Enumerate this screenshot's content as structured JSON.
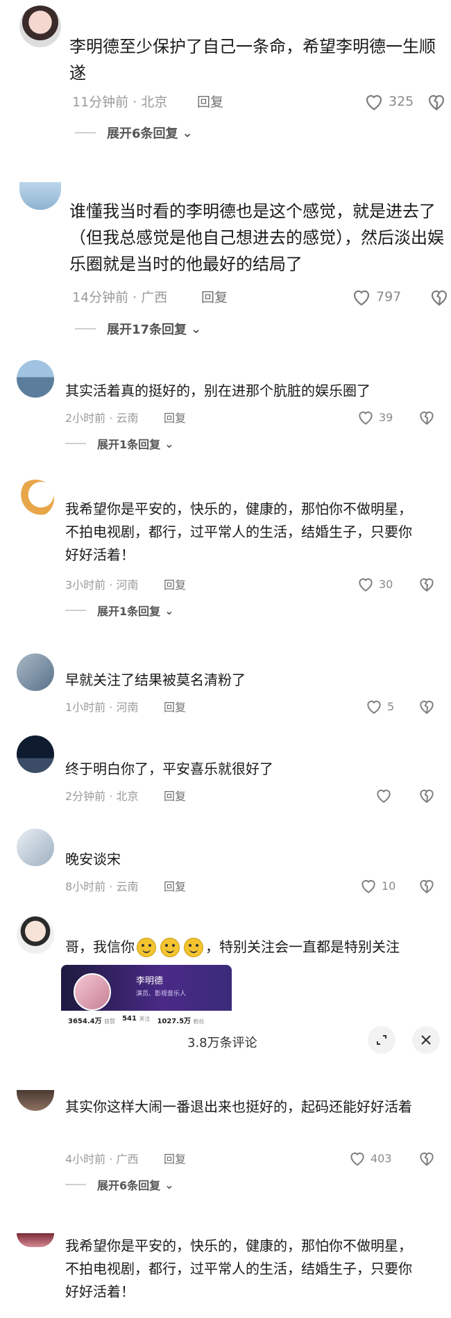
{
  "comments": [
    {
      "text": "李明德至少保护了自己一条命，希望李明德一生顺遂",
      "time_loc": "11分钟前 · 北京",
      "reply": "回复",
      "likes": "325",
      "expand": "展开6条回复"
    },
    {
      "text": "谁懂我当时看的李明德也是这个感觉，就是进去了（但我总感觉是他自己想进去的感觉），然后淡出娱乐圈就是当时的他最好的结局了",
      "time_loc": "14分钟前 · 广西",
      "reply": "回复",
      "likes": "797",
      "expand": "展开17条回复"
    },
    {
      "text": "其实活着真的挺好的，别在进那个肮脏的娱乐圈了",
      "time_loc": "2小时前 · 云南",
      "reply": "回复",
      "likes": "39",
      "expand": "展开1条回复"
    },
    {
      "text": "我希望你是平安的，快乐的，健康的，那怕你不做明星，不拍电视剧，都行，过平常人的生活，结婚生子，只要你好好活着！",
      "time_loc": "3小时前 · 河南",
      "reply": "回复",
      "likes": "30",
      "expand": "展开1条回复"
    },
    {
      "text": "早就关注了结果被莫名清粉了",
      "time_loc": "1小时前 · 河南",
      "reply": "回复",
      "likes": "5"
    },
    {
      "text": "终于明白你了，平安喜乐就很好了",
      "time_loc": "2分钟前 · 北京",
      "reply": "回复",
      "likes": ""
    },
    {
      "text": "晚安谈宋",
      "time_loc": "8小时前 · 云南",
      "reply": "回复",
      "likes": "10"
    },
    {
      "text": "哥，我信你",
      "text_after": "，特别关注会一直都是特别关注"
    },
    {
      "text": "其实你这样大闹一番退出来也挺好的，起码还能好好活着",
      "time_loc": "4小时前 · 广西",
      "reply": "回复",
      "likes": "403",
      "expand": "展开6条回复"
    },
    {
      "text": "我希望你是平安的，快乐的，健康的，那怕你不做明星，不拍电视剧，都行，过平常人的生活，结婚生子，只要你好好活着！"
    }
  ],
  "profile_card": {
    "name": "李明德",
    "subtitle": "演员、影视音乐人",
    "stat1_value": "3654.4万",
    "stat1_label": "获赞",
    "stat2_value": "541",
    "stat2_label": "关注",
    "stat3_value": "1027.5万",
    "stat3_label": "粉丝"
  },
  "overlay": {
    "count_label": "3.8万条评论"
  },
  "colors": {
    "meta": "#9a9a9a",
    "heart": "#7d7d7d",
    "card_bg": "#2d2466"
  }
}
